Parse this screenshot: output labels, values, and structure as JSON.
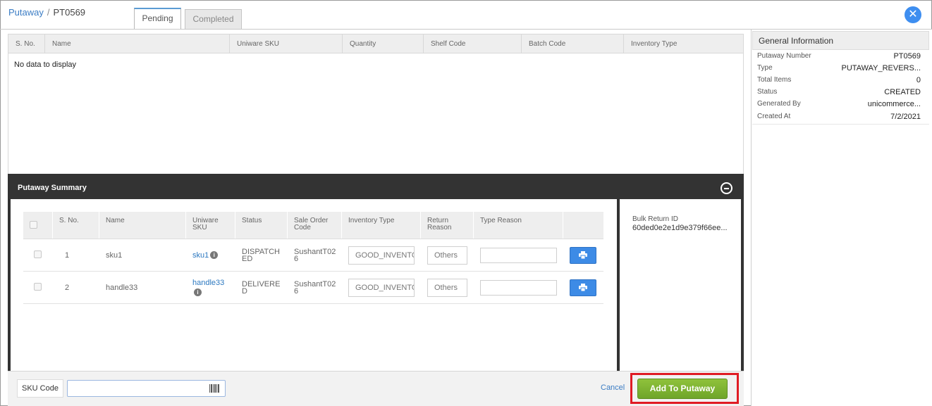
{
  "breadcrumb": {
    "root": "Putaway",
    "separator": "/",
    "current": "PT0569"
  },
  "tabs": [
    {
      "label": "Pending",
      "active": true
    },
    {
      "label": "Completed",
      "active": false
    }
  ],
  "pending_grid": {
    "columns": [
      "S. No.",
      "Name",
      "Uniware SKU",
      "Quantity",
      "Shelf Code",
      "Batch Code",
      "Inventory Type"
    ],
    "empty_text": "No data to display"
  },
  "summary": {
    "title": "Putaway Summary",
    "columns": [
      "S. No.",
      "Name",
      "Uniware SKU",
      "Status",
      "Sale Order Code",
      "Inventory Type",
      "Return Reason",
      "Type Reason"
    ],
    "rows": [
      {
        "sno": "1",
        "name": "sku1",
        "sku": "sku1",
        "status": "DISPATCHED",
        "sale_order": "SushantT026",
        "inventory_type": "GOOD_INVENTORY",
        "return_reason": "Others",
        "type_reason": ""
      },
      {
        "sno": "2",
        "name": "handle33",
        "sku": "handle33",
        "status": "DELIVERED",
        "sale_order": "SushantT026",
        "inventory_type": "GOOD_INVENTORY",
        "return_reason": "Others",
        "type_reason": ""
      }
    ],
    "bulk_return_label": "Bulk Return ID",
    "bulk_return_value": "60ded0e2e1d9e379f66ee..."
  },
  "footer": {
    "sku_label": "SKU Code",
    "sku_value": "",
    "cancel": "Cancel",
    "add_button": "Add To Putaway"
  },
  "general_info": {
    "title": "General Information",
    "rows": [
      {
        "key": "Putaway Number",
        "value": "PT0569"
      },
      {
        "key": "Type",
        "value": "PUTAWAY_REVERS..."
      },
      {
        "key": "Total Items",
        "value": "0"
      },
      {
        "key": "Status",
        "value": "CREATED"
      },
      {
        "key": "Generated By",
        "value": "unicommerce..."
      },
      {
        "key": "Created At",
        "value": "7/2/2021"
      }
    ]
  },
  "colors": {
    "accent": "#3e8ef0",
    "link": "#3a7cc4",
    "add_button": "#7ab32e",
    "highlight": "#e01b24",
    "summary_bar": "#333333"
  }
}
